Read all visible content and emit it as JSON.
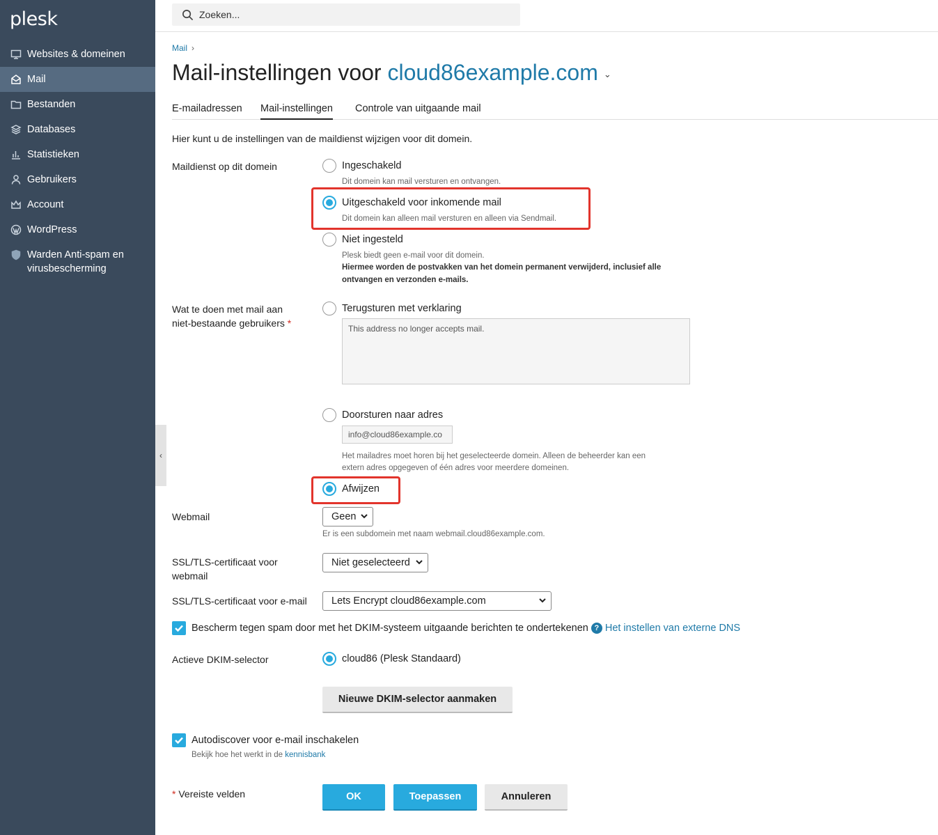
{
  "app": {
    "logo_text": "plesk"
  },
  "sidebar": {
    "items": [
      {
        "label": "Websites & domeinen",
        "icon": "monitor-icon"
      },
      {
        "label": "Mail",
        "icon": "mail-icon"
      },
      {
        "label": "Bestanden",
        "icon": "folder-icon"
      },
      {
        "label": "Databases",
        "icon": "layers-icon"
      },
      {
        "label": "Statistieken",
        "icon": "bar-chart-icon"
      },
      {
        "label": "Gebruikers",
        "icon": "user-icon"
      },
      {
        "label": "Account",
        "icon": "crown-icon"
      },
      {
        "label": "WordPress",
        "icon": "wordpress-icon"
      },
      {
        "label": "Warden Anti-spam en virusbescherming",
        "icon": "shield-icon"
      }
    ]
  },
  "search": {
    "placeholder": "Zoeken..."
  },
  "breadcrumb": {
    "item": "Mail"
  },
  "page": {
    "title_prefix": "Mail-instellingen voor",
    "domain": "cloud86example.com"
  },
  "tabs": [
    "E-mailadressen",
    "Mail-instellingen",
    "Controle van uitgaande mail"
  ],
  "intro": "Hier kunt u de instellingen van de maildienst wijzigen voor dit domein.",
  "mail_service": {
    "label": "Maildienst op dit domein",
    "options": [
      {
        "label": "Ingeschakeld",
        "hint": "Dit domein kan mail versturen en ontvangen."
      },
      {
        "label": "Uitgeschakeld voor inkomende mail",
        "hint": "Dit domein kan alleen mail versturen en alleen via Sendmail."
      },
      {
        "label": "Niet ingesteld",
        "hint": "Plesk biedt geen e-mail voor dit domein.",
        "hint_bold_1": "Hiermee worden de postvakken van het domein permanent verwijderd, inclusief alle",
        "hint_bold_2": "ontvangen en verzonden e-mails."
      }
    ]
  },
  "nonexistent": {
    "label_1": "Wat te doen met mail aan",
    "label_2": "niet-bestaande gebruikers",
    "required_mark": "*",
    "bounce_label": "Terugsturen met verklaring",
    "bounce_message": "This address no longer accepts mail.",
    "forward_label": "Doorsturen naar adres",
    "forward_value": "info@cloud86example.co",
    "forward_hint_1": "Het mailadres moet horen bij het geselecteerde domein. Alleen de beheerder kan een",
    "forward_hint_2": "extern adres opgegeven of één adres voor meerdere domeinen.",
    "reject_label": "Afwijzen"
  },
  "webmail": {
    "label": "Webmail",
    "value": "Geen",
    "hint": "Er is een subdomein met naam webmail.cloud86example.com."
  },
  "ssl_webmail": {
    "label_1": "SSL/TLS-certificaat voor",
    "label_2": "webmail",
    "value": "Niet geselecteerd"
  },
  "ssl_email": {
    "label": "SSL/TLS-certificaat voor e-mail",
    "value": "Lets Encrypt cloud86example.com"
  },
  "dkim": {
    "label": "Bescherm tegen spam door met het DKIM-systeem uitgaande berichten te ondertekenen",
    "help_mark": "?",
    "link": "Het instellen van externe DNS",
    "selector_label": "Actieve DKIM-selector",
    "selector_value": "cloud86 (Plesk Standaard)",
    "new_selector_button": "Nieuwe DKIM-selector aanmaken"
  },
  "autodiscover": {
    "label": "Autodiscover voor e-mail inschakelen",
    "hint_prefix": "Bekijk hoe het werkt in de",
    "hint_link": "kennisbank"
  },
  "footer": {
    "required_mark": "*",
    "required_text": "Vereiste velden",
    "ok": "OK",
    "apply": "Toepassen",
    "cancel": "Annuleren"
  },
  "colors": {
    "sidebar": "#3a4a5c",
    "sidebar_active": "#566b81",
    "accent": "#28aade",
    "link": "#1f7aa8",
    "highlight": "#e2342c"
  }
}
